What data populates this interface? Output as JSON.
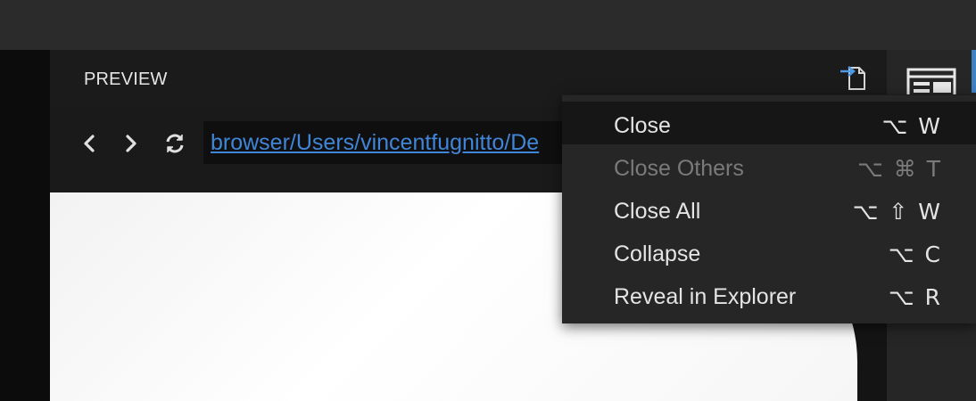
{
  "panel": {
    "title": "PREVIEW"
  },
  "toolbar": {
    "back_icon": "chevron-left-icon",
    "forward_icon": "chevron-right-icon",
    "refresh_icon": "refresh-icon",
    "url": "browser/Users/vincentfugnitto/De"
  },
  "header": {
    "action_icon": "split-file-icon"
  },
  "context_menu": {
    "items": [
      {
        "label": "Close",
        "shortcut": "⌥ W",
        "enabled": true,
        "highlighted": true
      },
      {
        "label": "Close Others",
        "shortcut": "⌥ ⌘ T",
        "enabled": false,
        "highlighted": false
      },
      {
        "label": "Close All",
        "shortcut": "⌥ ⇧ W",
        "enabled": true,
        "highlighted": false
      },
      {
        "label": "Collapse",
        "shortcut": "⌥ C",
        "enabled": true,
        "highlighted": false
      },
      {
        "label": "Reveal in Explorer",
        "shortcut": "⌥ R",
        "enabled": true,
        "highlighted": false
      }
    ]
  },
  "colors": {
    "link": "#3f86d8",
    "accent": "#3b82c4",
    "menu_bg": "#262626",
    "menu_highlight": "#161616",
    "disabled_text": "#7a7a7a"
  }
}
